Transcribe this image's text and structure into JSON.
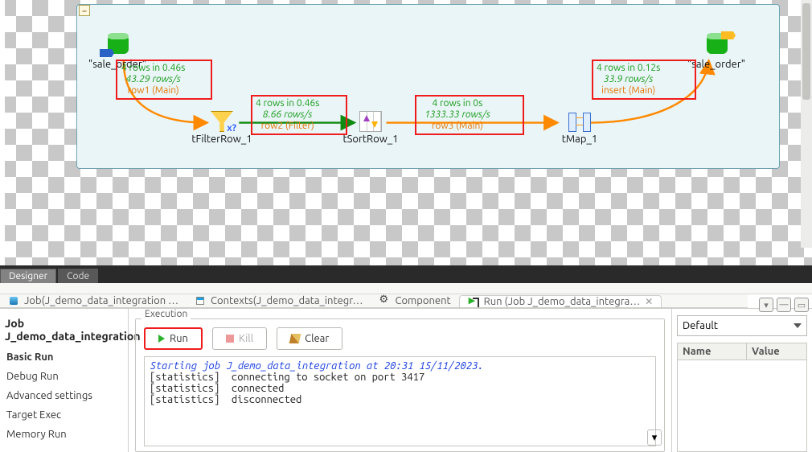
{
  "job_subprocess": {
    "source_db_label": "\"sale_order\"",
    "target_db_label": "\"sale_order\"",
    "filter_label": "tFilterRow_1",
    "sort_label": "tSortRow_1",
    "tmap_label": "tMap_1"
  },
  "flows": {
    "row1": {
      "stats": "4 rows in 0.46s",
      "rate": "43.29 rows/s",
      "name": "row1 (Main)"
    },
    "row2": {
      "stats": "4 rows in 0.46s",
      "rate": "8.66 rows/s",
      "name": "row2 (Filter)"
    },
    "row3": {
      "stats": "4 rows in 0s",
      "rate": "1333.33 rows/s",
      "name": "row3 (Main)"
    },
    "insert": {
      "stats": "4 rows in 0.12s",
      "rate": "33.9 rows/s",
      "name": "insert (Main)"
    }
  },
  "designer_tabs": {
    "designer": "Designer",
    "code": "Code"
  },
  "view_tabs": {
    "job": "Job(J_demo_data_integration …",
    "contexts": "Contexts(J_demo_data_integr…",
    "component": "Component",
    "run": "Run (Job J_demo_data_integra…"
  },
  "panel": {
    "title": "Job J_demo_data_integration",
    "left_items": [
      "Basic Run",
      "Debug Run",
      "Advanced settings",
      "Target Exec",
      "Memory Run"
    ],
    "selected_left": 0,
    "exec_label": "Execution",
    "buttons": {
      "run": "Run",
      "kill": "Kill",
      "clear": "Clear"
    },
    "console_start": "Starting job J_demo_data_integration at 20:31 15/11/2023.",
    "console_lines": [
      "[statistics]  connecting to socket on port 3417",
      "[statistics]  connected",
      "[statistics]  disconnected"
    ],
    "context_selected": "Default",
    "table_headers": {
      "name": "Name",
      "value": "Value"
    }
  }
}
